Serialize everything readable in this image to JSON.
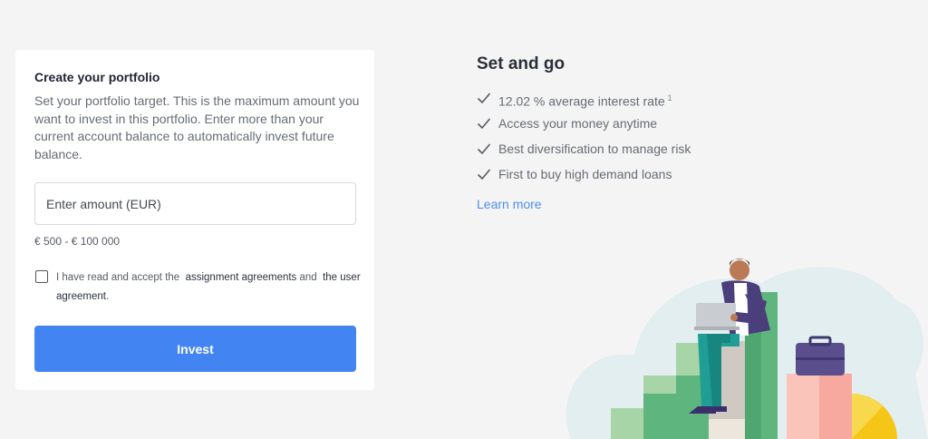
{
  "form": {
    "title": "Create your portfolio",
    "description": "Set your portfolio target. This is the maximum amount you want to invest in this portfolio. Enter more than your current account balance to automatically invest future balance.",
    "amount_placeholder": "Enter amount (EUR)",
    "amount_value": "",
    "range_hint": "€ 500 - € 100 000",
    "agree_prefix": "I have read and accept the",
    "agree_link_1": "assignment agreements",
    "agree_and": "and",
    "agree_link_2": "the user agreement",
    "agree_suffix": ".",
    "checkbox_checked": false,
    "invest_label": "Invest"
  },
  "side": {
    "title": "Set and go",
    "benefits": [
      {
        "text": "12.02 % average interest rate",
        "sup": "1"
      },
      {
        "text": "Access your money anytime"
      },
      {
        "text": "Best diversification to manage risk"
      },
      {
        "text": "First to buy high demand loans"
      }
    ],
    "learn_more": "Learn more"
  },
  "colors": {
    "accent": "#4384f3",
    "link": "#4f8ef0",
    "background": "#f4f4f4",
    "card": "#ffffff",
    "check": "#555b66"
  },
  "icons": {
    "benefit_check": "check-icon"
  }
}
